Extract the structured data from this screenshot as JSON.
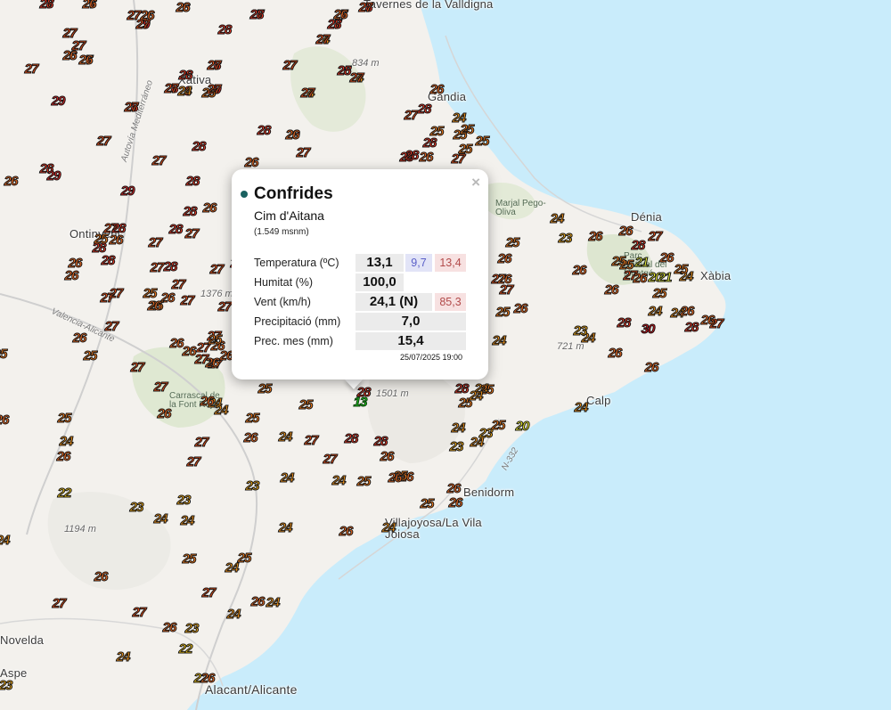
{
  "colors": {
    "sea": "#c9ecfb",
    "land": "#f3f1ed",
    "t20": "#ffff33",
    "t21": "#e6f03a",
    "t22": "#f5c816",
    "t23": "#f3ac18",
    "t24": "#f39419",
    "t25": "#f27a1a",
    "t26": "#ee6a21",
    "t27": "#ec4f17",
    "t28": "#e53522",
    "t29": "#dd2424",
    "t30": "#d8121a",
    "selected": "#1ec21e",
    "station_dot": "#1a6160"
  },
  "map_labels": {
    "towns": [
      "Tavernes de la Valldigna",
      "Dénia",
      "Xàbia",
      "Calp",
      "Benidorm",
      "Villajoyosa/La Vila Joiosa",
      "Alacant/Alicante",
      "Ontinyent",
      "Xàtiva",
      "Gandia",
      "Novelda",
      "Aspe"
    ],
    "elevations": [
      "834 m",
      "1376 m",
      "1501 m",
      "721 m",
      "1194 m"
    ],
    "roads": [
      "Autovía Mediterráneo",
      "Valencia-Alicante",
      "N-332"
    ],
    "parks": [
      "Marjal Pego-Oliva",
      "Parc Natural del Montgó",
      "Carrascal de la Font Roja"
    ]
  },
  "station_values": [
    27,
    27,
    27,
    26,
    28,
    27,
    27,
    28,
    29,
    27,
    27,
    27,
    24,
    27,
    25,
    24,
    24,
    27,
    28,
    26,
    28,
    28,
    29,
    29,
    28,
    28,
    27,
    27,
    29,
    28,
    29,
    28,
    28,
    27,
    27,
    26,
    26,
    27,
    28,
    24,
    25,
    28,
    28,
    26,
    25,
    25,
    26,
    28,
    29,
    29,
    28,
    28,
    26,
    27,
    27,
    28,
    25,
    26,
    28,
    28,
    26,
    26,
    27,
    27,
    27,
    28,
    27,
    27,
    28,
    27,
    26,
    28,
    26,
    27,
    25,
    25,
    27,
    27,
    26,
    26,
    27,
    27,
    27,
    26,
    26,
    27,
    26,
    25,
    27,
    27,
    26,
    27,
    26,
    24,
    24,
    26,
    25,
    26,
    25,
    25,
    25,
    26,
    27,
    27,
    28,
    28,
    26,
    26,
    27,
    27,
    23,
    24,
    24,
    24,
    25,
    25,
    26,
    23,
    24,
    23,
    25,
    20,
    24,
    25,
    24,
    25,
    24,
    25,
    24,
    26,
    26,
    26,
    25,
    24,
    26,
    22,
    23,
    24,
    23,
    24,
    24,
    25,
    24,
    25,
    26,
    27,
    27,
    27,
    24,
    26,
    24,
    26,
    23,
    22,
    24,
    22,
    26,
    23,
    24,
    26,
    24,
    23,
    26,
    26,
    28,
    27,
    21,
    25,
    25,
    26,
    25,
    26,
    27,
    26,
    25,
    26,
    24,
    26,
    26,
    27,
    26,
    20,
    21,
    24,
    25,
    25,
    24,
    24,
    26,
    26,
    27,
    28,
    28,
    26,
    30,
    24,
    23,
    26,
    24,
    25,
    27,
    25,
    28,
    26,
    25,
    27,
    28,
    28,
    28,
    26,
    27,
    26,
    26,
    28,
    26,
    27,
    27,
    27,
    27,
    26,
    27,
    28,
    28,
    27,
    27,
    27,
    27,
    28,
    27,
    24,
    25,
    27,
    26,
    27,
    27
  ],
  "selected_station_value": 13,
  "popup": {
    "close_label": "×",
    "station_name": "Confrides",
    "station_subtitle": "Cim d'Aitana",
    "altitude": "(1.549 msnm)",
    "rows": {
      "temperature": {
        "label": "Temperatura (ºC)",
        "value": "13,1",
        "min": "9,7",
        "max": "13,4"
      },
      "humidity": {
        "label": "Humitat (%)",
        "value": "100,0"
      },
      "wind": {
        "label": "Vent (km/h)",
        "value": "24,1 (N)",
        "gust": "85,3"
      },
      "precipitation": {
        "label": "Precipitació (mm)",
        "value": "7,0"
      },
      "monthly_precipitation": {
        "label": "Prec. mes (mm)",
        "value": "15,4"
      }
    },
    "timestamp": "25/07/2025 19:00"
  }
}
